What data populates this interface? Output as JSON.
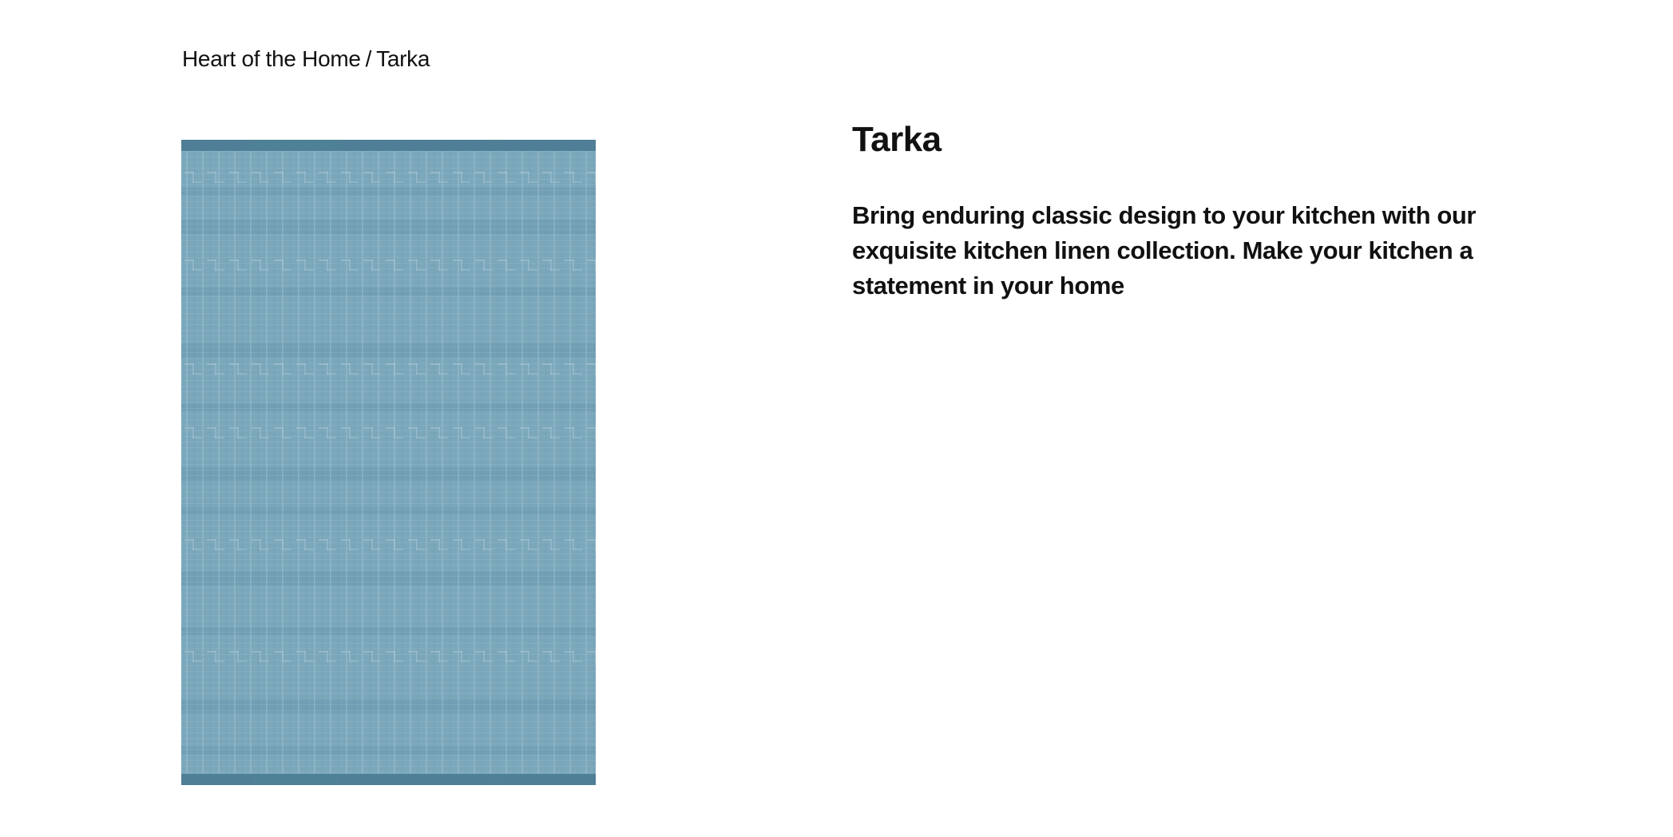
{
  "breadcrumb": {
    "parent": "Heart of the Home",
    "separator": "/",
    "current": "Tarka"
  },
  "product": {
    "image_label": "Tarka",
    "title": "Tarka",
    "description": "Bring enduring classic design to your kitchen with our exquisite kitchen linen collection. Make your kitchen a statement in your home"
  },
  "colors": {
    "fabric_base": "#7ba7bb",
    "fabric_light": "#a9c8d6",
    "fabric_dark": "#4f7f96",
    "fabric_border": "#46798f"
  }
}
